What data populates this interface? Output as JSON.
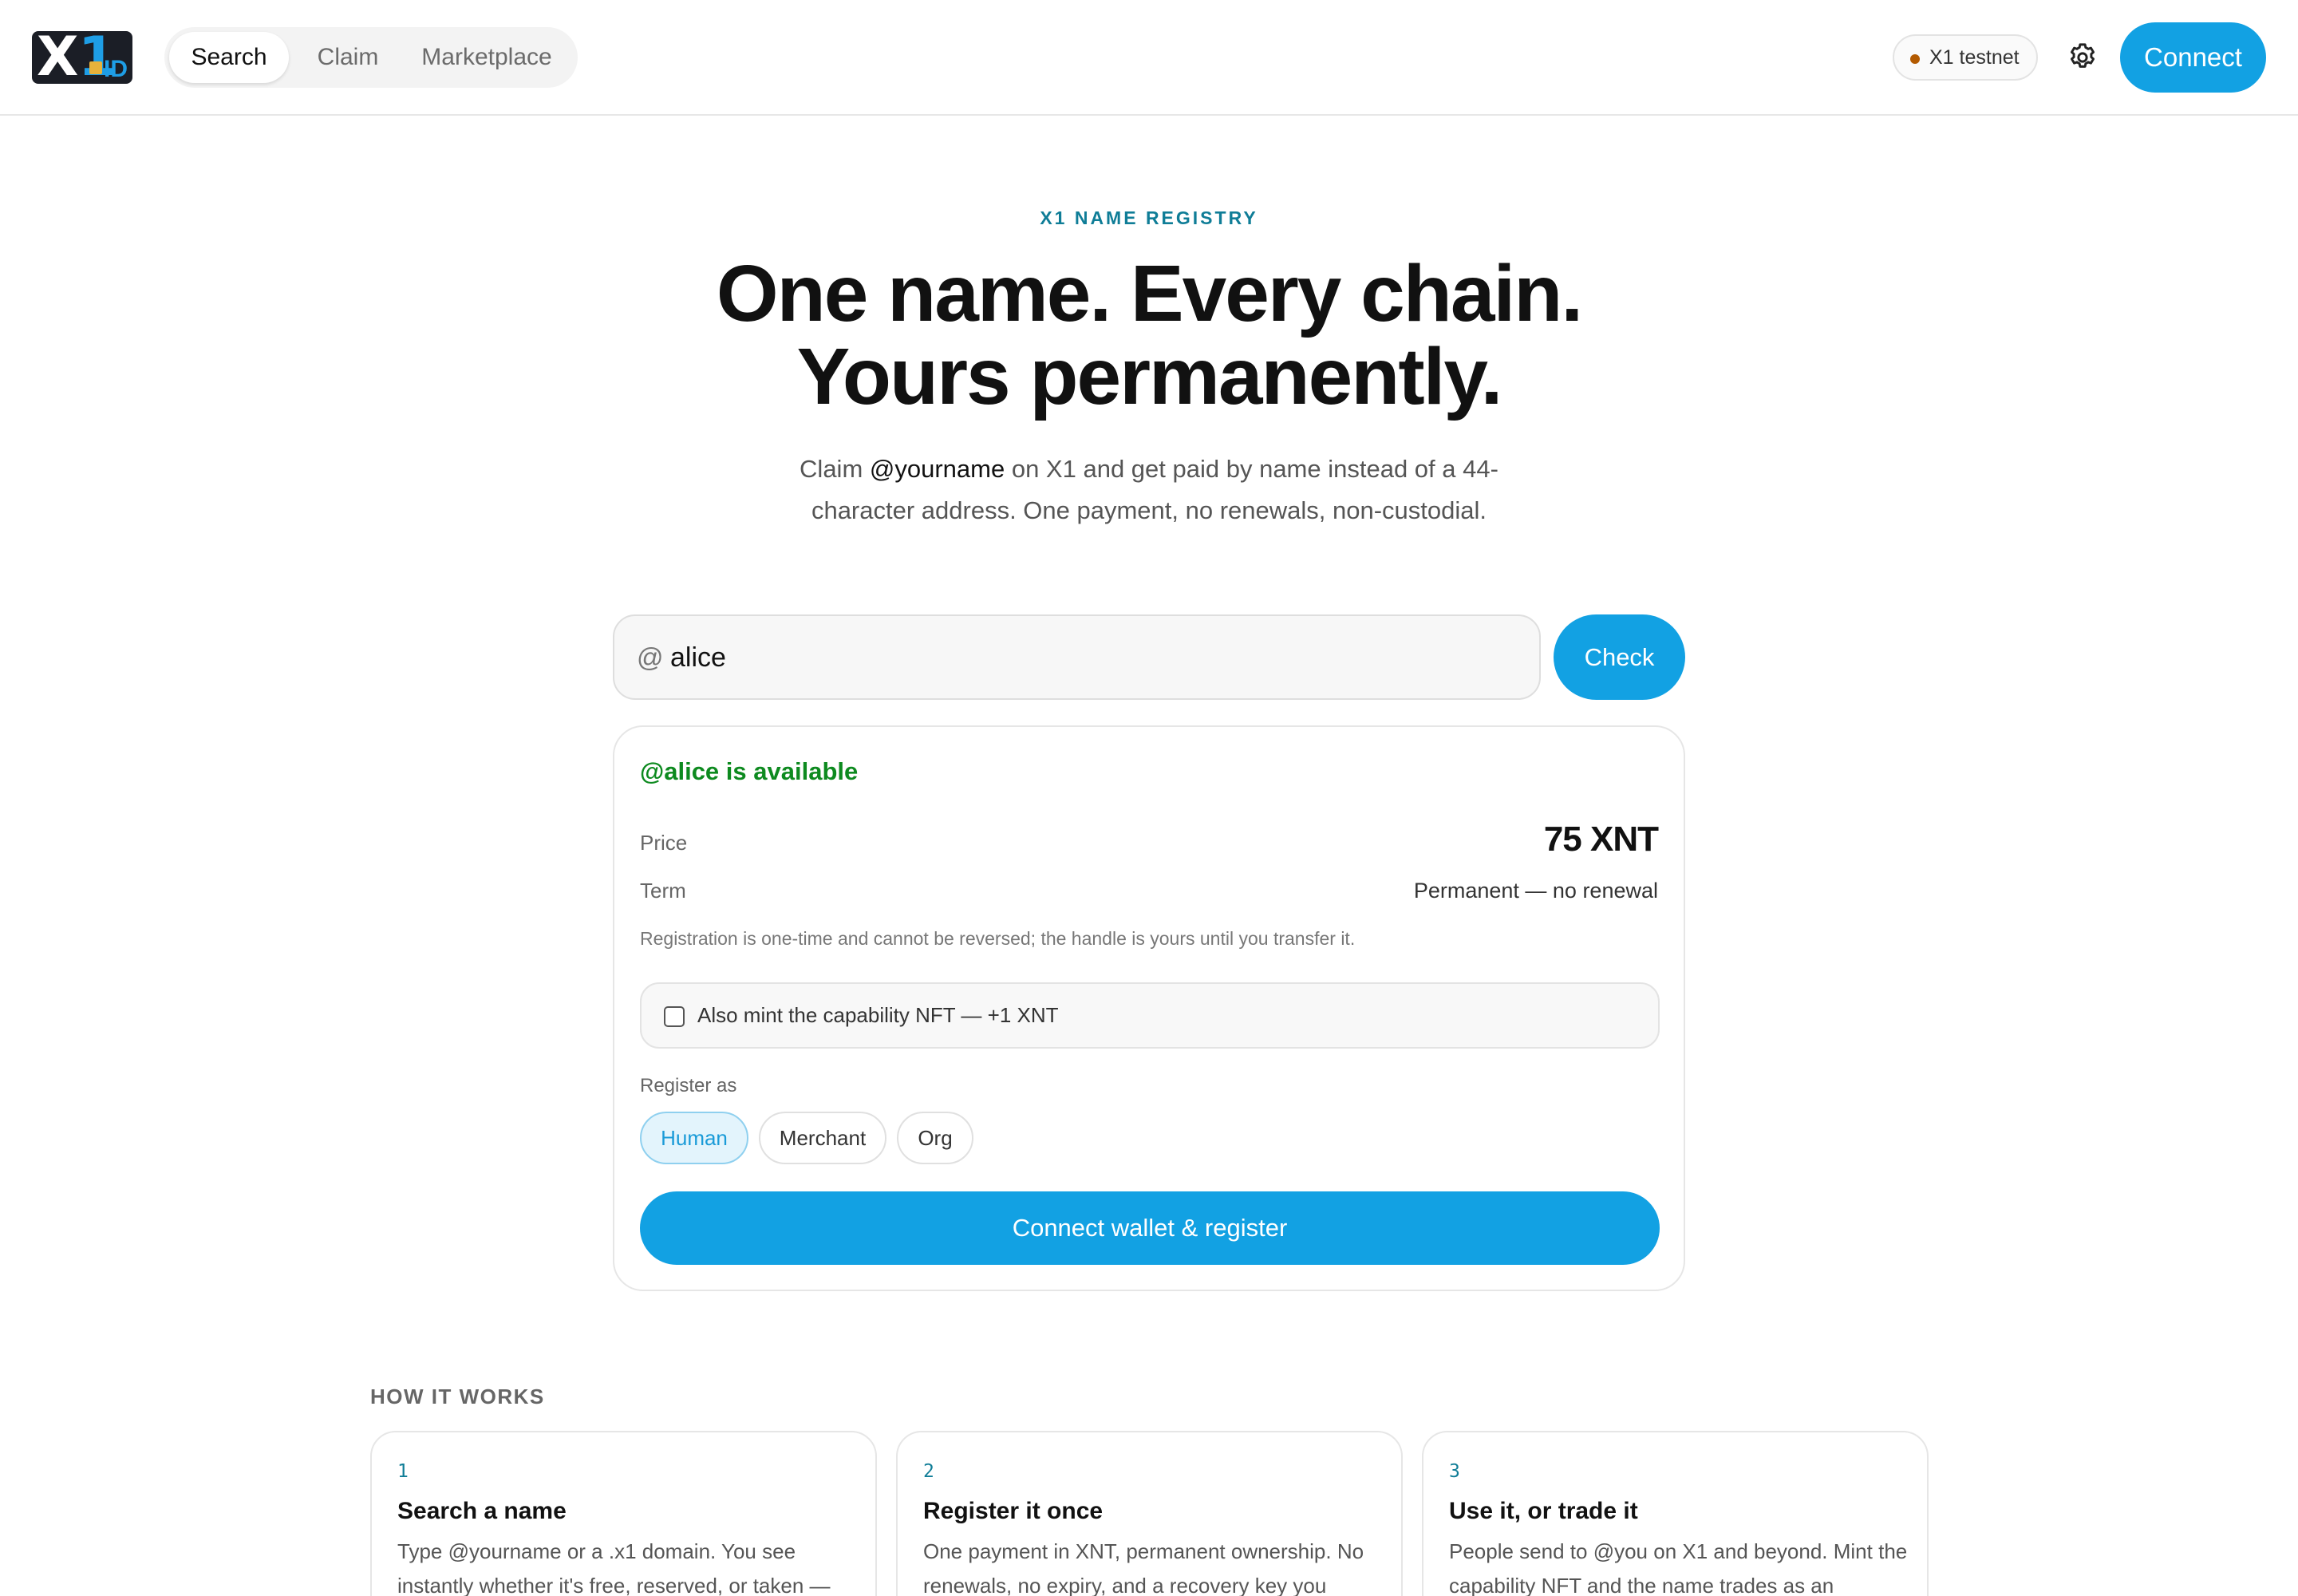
{
  "header": {
    "logo_text_main": "X",
    "logo_text_accent": "1",
    "logo_text_sub": "ID",
    "nav": {
      "search": "Search",
      "claim": "Claim",
      "marketplace": "Marketplace"
    },
    "network_badge": "X1 testnet",
    "connect_label": "Connect",
    "colors": {
      "accent": "#12a1e3",
      "network_dot": "#b35a00"
    }
  },
  "hero": {
    "eyebrow": "X1 NAME REGISTRY",
    "headline_line1": "One name. Every chain.",
    "headline_line2": "Yours permanently.",
    "sub_pre": "Claim ",
    "sub_handle": "@yourname",
    "sub_post": " on X1 and get paid by name instead of a 44-character address. One payment, no renewals, non-custodial."
  },
  "search": {
    "prefix": "@",
    "value": "alice",
    "button_label": "Check"
  },
  "result": {
    "status": "@alice is available",
    "price_label": "Price",
    "price_value": "75 XNT",
    "term_label": "Term",
    "term_value": "Permanent — no renewal",
    "note": "Registration is one-time and cannot be reversed; the handle is yours until you transfer it.",
    "nft_option": {
      "label": "Also mint the capability NFT — +1 XNT",
      "checked": false
    },
    "register_as_label": "Register as",
    "register_as_options": [
      "Human",
      "Merchant",
      "Org"
    ],
    "register_as_selected": "Human",
    "register_button": "Connect wallet & register",
    "colors": {
      "available": "#0d8a1f"
    }
  },
  "how_it_works": {
    "heading": "HOW IT WORKS",
    "steps": [
      {
        "num": "1",
        "title": "Search a name",
        "desc": "Type @yourname or a .x1 domain. You see instantly whether it's free, reserved, or taken —"
      },
      {
        "num": "2",
        "title": "Register it once",
        "desc": "One payment in XNT, permanent ownership. No renewals, no expiry, and a recovery key you"
      },
      {
        "num": "3",
        "title": "Use it, or trade it",
        "desc": "People send to @you on X1 and beyond. Mint the capability NFT and the name trades as an"
      }
    ]
  }
}
